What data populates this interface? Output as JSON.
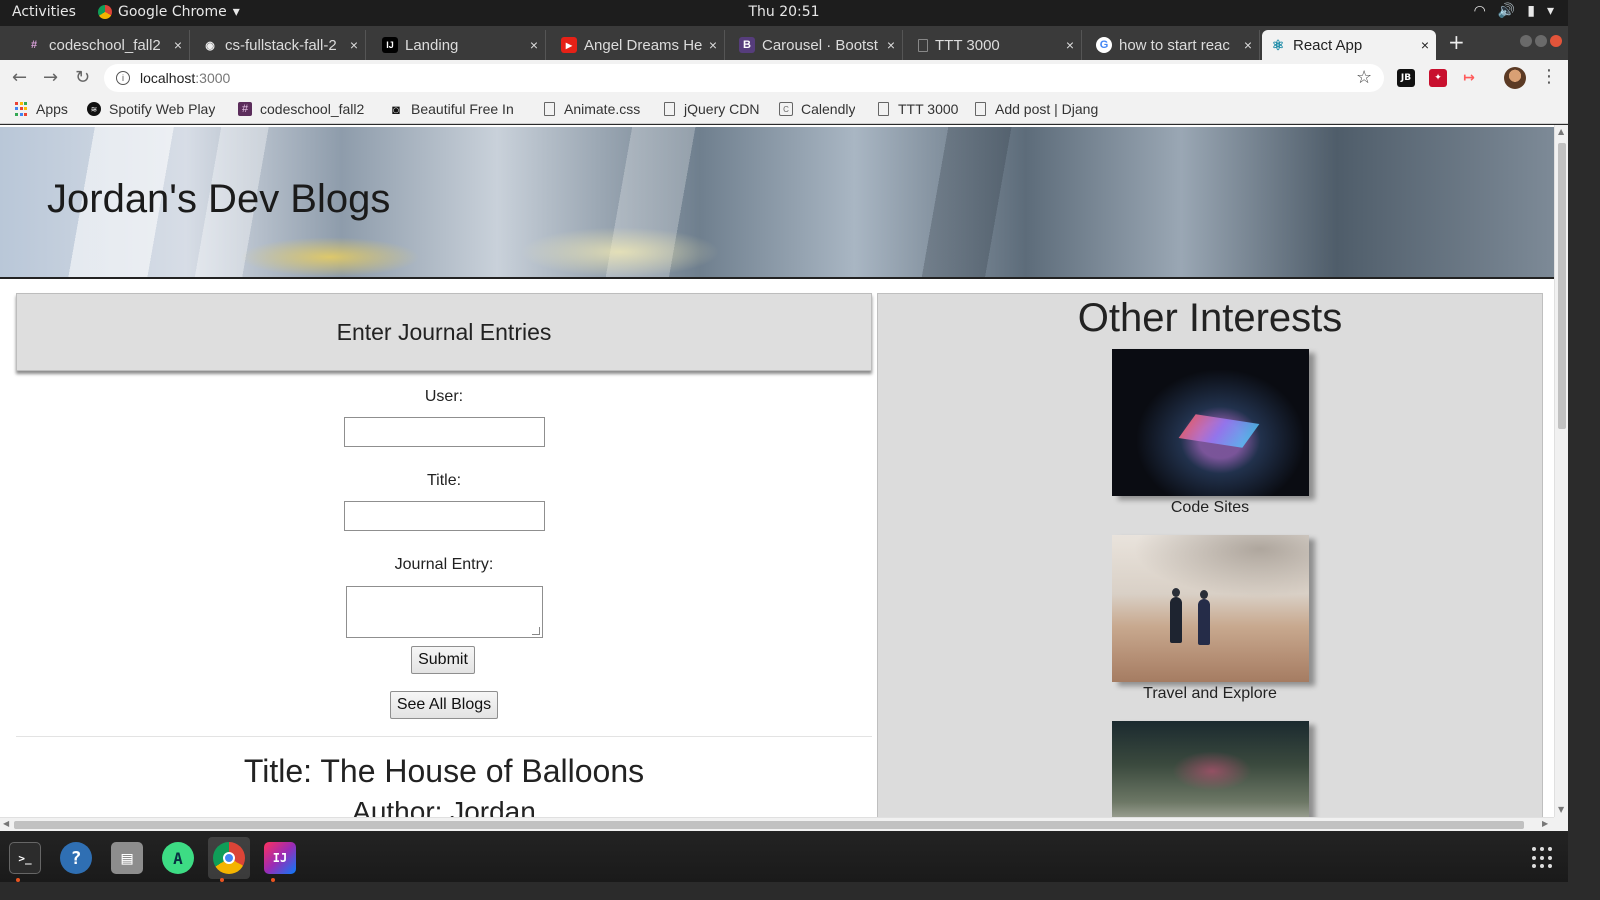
{
  "system_bar": {
    "activities": "Activities",
    "app_name": "Google Chrome",
    "app_menu_arrow": "▾",
    "clock": "Thu 20:51",
    "tray_icons": [
      "wifi-icon",
      "volume-icon",
      "battery-icon",
      "power-menu-icon"
    ],
    "tray_glyphs": [
      "◠",
      "🔊",
      "▮",
      "▾"
    ]
  },
  "tabs": [
    {
      "title": "codeschool_fall2",
      "favicon": "#",
      "favicon_color": "#5b2d5b"
    },
    {
      "title": "cs-fullstack-fall-2",
      "favicon": "◉",
      "favicon_color": "#222222"
    },
    {
      "title": "Landing",
      "favicon": "IJ",
      "favicon_color": "#000000"
    },
    {
      "title": "Angel Dreams He",
      "favicon": "▶",
      "favicon_color": "#e62117"
    },
    {
      "title": "Carousel · Bootst",
      "favicon": "B",
      "favicon_color": "#563d7c"
    },
    {
      "title": "TTT 3000",
      "favicon": "",
      "favicon_color": "#777777"
    },
    {
      "title": "how to start reac",
      "favicon": "G",
      "favicon_color": "#4285f4"
    },
    {
      "title": "React App",
      "favicon": "⚛",
      "favicon_color": "#1c8ba8"
    }
  ],
  "tab_close": "×",
  "new_tab": "+",
  "toolbar": {
    "back": "←",
    "forward": "→",
    "reload": "↻",
    "info": "i",
    "url_host": "localhost",
    "url_port": ":3000",
    "bookmark_star": "☆",
    "extensions": [
      {
        "label": "JB",
        "color": "#111111"
      },
      {
        "label": "✦",
        "color": "#c8102e"
      },
      {
        "label": "↦",
        "color": "#ff5a5a"
      }
    ],
    "menu": "⋮"
  },
  "bookmarks": [
    {
      "label": "Apps",
      "icon": "apps"
    },
    {
      "label": "Spotify Web Play",
      "icon": "spotify"
    },
    {
      "label": "codeschool_fall2",
      "icon": "slack"
    },
    {
      "label": "Beautiful Free In",
      "icon": "camera"
    },
    {
      "label": "Animate.css",
      "icon": "doc"
    },
    {
      "label": "jQuery CDN",
      "icon": "doc"
    },
    {
      "label": "Calendly",
      "icon": "calendly"
    },
    {
      "label": "TTT 3000",
      "icon": "doc"
    },
    {
      "label": "Add post | Djang",
      "icon": "doc"
    }
  ],
  "page": {
    "site_title": "Jordan's Dev Blogs",
    "form": {
      "heading": "Enter Journal Entries",
      "user_label": "User:",
      "user_value": "",
      "title_label": "Title:",
      "title_value": "",
      "entry_label": "Journal Entry:",
      "entry_value": "",
      "submit_label": "Submit",
      "see_all_label": "See All Blogs"
    },
    "entry": {
      "title": "Title: The House of Balloons",
      "author": "Author: Jordan"
    },
    "interests": {
      "heading": "Other Interests",
      "cards": [
        {
          "caption": "Code Sites"
        },
        {
          "caption": "Travel and Explore"
        },
        {
          "caption": ""
        }
      ]
    }
  },
  "dock": [
    {
      "name": "terminal",
      "glyph": ">_",
      "color": "#2c2c2c",
      "running": true
    },
    {
      "name": "help",
      "glyph": "?",
      "color": "#2f6fb3",
      "running": false
    },
    {
      "name": "files",
      "glyph": "▤",
      "color": "#8d8d8d",
      "running": false
    },
    {
      "name": "android-studio",
      "glyph": "A",
      "color": "#3ddc84",
      "running": false
    },
    {
      "name": "chrome",
      "glyph": "◎",
      "color": "#db4437",
      "running": true
    },
    {
      "name": "intellij",
      "glyph": "IJ",
      "color": "#9b2bb5",
      "running": true
    }
  ]
}
